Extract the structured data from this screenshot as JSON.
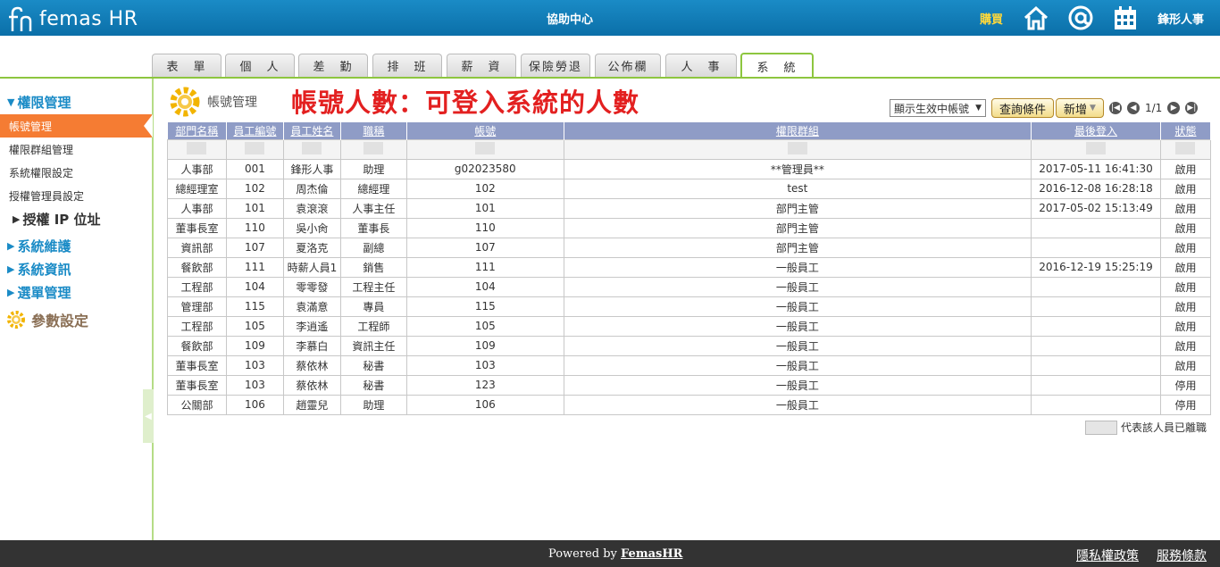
{
  "header": {
    "logo_text": "femas HR",
    "help_center": "協助中心",
    "buy": "購買",
    "user_name": "鋒形人事",
    "icons": [
      "home-icon",
      "at-icon",
      "calendar-icon"
    ]
  },
  "tabs": [
    {
      "label": "表　單"
    },
    {
      "label": "個　人"
    },
    {
      "label": "差　勤"
    },
    {
      "label": "排　班"
    },
    {
      "label": "薪　資"
    },
    {
      "label": "保險勞退"
    },
    {
      "label": "公佈欄"
    },
    {
      "label": "人　事"
    },
    {
      "label": "系　統"
    }
  ],
  "sidebar": {
    "section1": "權限管理",
    "items": [
      "帳號管理",
      "權限群組管理",
      "系統權限設定",
      "授權管理員設定"
    ],
    "ip": "授權 IP 位址",
    "section2": "系統維護",
    "section3": "系統資訊",
    "section4": "選單管理",
    "params": "參數設定"
  },
  "page": {
    "title": "帳號管理",
    "annotation": "帳號人數：可登入系統的人數"
  },
  "toolbar": {
    "filter_value": "顯示生效中帳號",
    "query_button": "查詢條件",
    "add_button": "新增",
    "page_info": "1/1"
  },
  "table": {
    "headers": [
      "部門名稱",
      "員工編號",
      "員工姓名",
      "職稱",
      "帳號",
      "權限群組",
      "最後登入",
      "狀態"
    ],
    "rows": [
      [
        "人事部",
        "001",
        "鋒形人事",
        "助理",
        "g02023580",
        "**管理員**",
        "2017-05-11 16:41:30",
        "啟用"
      ],
      [
        "總經理室",
        "102",
        "周杰倫",
        "總經理",
        "102",
        "test",
        "2016-12-08 16:28:18",
        "啟用"
      ],
      [
        "人事部",
        "101",
        "袁滾滾",
        "人事主任",
        "101",
        "部門主管",
        "2017-05-02 15:13:49",
        "啟用"
      ],
      [
        "董事長室",
        "110",
        "吳小肏",
        "董事長",
        "110",
        "部門主管",
        "",
        "啟用"
      ],
      [
        "資訊部",
        "107",
        "夏洛克",
        "副總",
        "107",
        "部門主管",
        "",
        "啟用"
      ],
      [
        "餐飲部",
        "111",
        "時薪人員1",
        "銷售",
        "111",
        "一般員工",
        "2016-12-19 15:25:19",
        "啟用"
      ],
      [
        "工程部",
        "104",
        "零零發",
        "工程主任",
        "104",
        "一般員工",
        "",
        "啟用"
      ],
      [
        "管理部",
        "115",
        "袁滿意",
        "專員",
        "115",
        "一般員工",
        "",
        "啟用"
      ],
      [
        "工程部",
        "105",
        "李逍遙",
        "工程師",
        "105",
        "一般員工",
        "",
        "啟用"
      ],
      [
        "餐飲部",
        "109",
        "李慕白",
        "資訊主任",
        "109",
        "一般員工",
        "",
        "啟用"
      ],
      [
        "董事長室",
        "103",
        "蔡依林",
        "秘書",
        "103",
        "一般員工",
        "",
        "啟用"
      ],
      [
        "董事長室",
        "103",
        "蔡依林",
        "秘書",
        "123",
        "一般員工",
        "",
        "停用"
      ],
      [
        "公關部",
        "106",
        "趙靈兒",
        "助理",
        "106",
        "一般員工",
        "",
        "停用"
      ]
    ],
    "legend": "代表該人員已離職"
  },
  "footer": {
    "powered_prefix": "Powered by ",
    "powered_link": "FemasHR",
    "privacy": "隱私權政策",
    "terms": "服務條款"
  },
  "colors": {
    "header_blue": "#0b6fa8",
    "accent_green": "#8dc63f",
    "active_orange": "#f57c33",
    "annotation_red": "#e32020",
    "table_header": "#8f9cc6"
  }
}
